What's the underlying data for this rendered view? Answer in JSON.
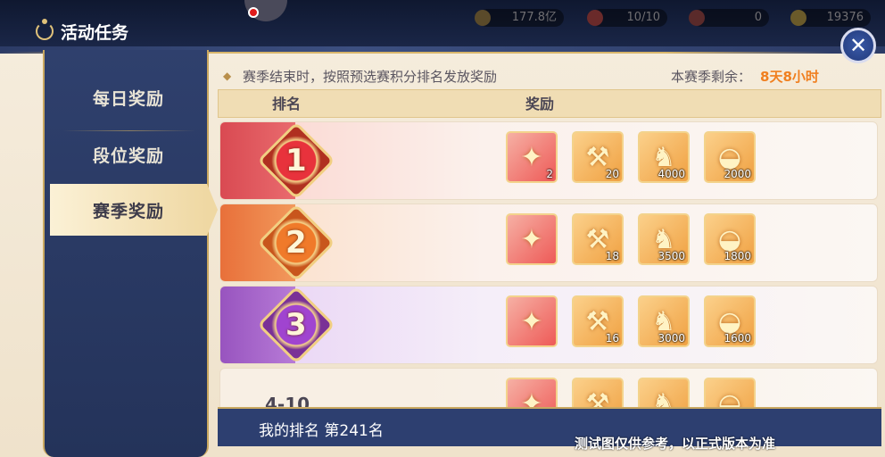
{
  "topbar": {
    "title": "活动任务",
    "resources": [
      "177.8亿",
      "10/10",
      "0",
      "19376"
    ],
    "colors": {
      "accent": "#e0c27a"
    }
  },
  "sidebar": {
    "items": [
      {
        "label": "每日奖励",
        "active": false
      },
      {
        "label": "段位奖励",
        "active": false
      },
      {
        "label": "赛季奖励",
        "active": true
      }
    ]
  },
  "notice": {
    "text": "赛季结束时，按照预选赛积分排名发放奖励",
    "remain_label": "本赛季剩余：",
    "remain_value": "8天8小时"
  },
  "table": {
    "col_rank": "排名",
    "col_reward": "奖励",
    "rows": [
      {
        "rank": "1",
        "items": [
          {
            "icon": "scepter-icon",
            "qty": "2"
          },
          {
            "icon": "hammer-icon",
            "qty": "20"
          },
          {
            "icon": "dragon-icon",
            "qty": "4000"
          },
          {
            "icon": "gold-ingot-icon",
            "qty": "2000"
          }
        ]
      },
      {
        "rank": "2",
        "items": [
          {
            "icon": "scepter-icon",
            "qty": ""
          },
          {
            "icon": "hammer-icon",
            "qty": "18"
          },
          {
            "icon": "dragon-icon",
            "qty": "3500"
          },
          {
            "icon": "gold-ingot-icon",
            "qty": "1800"
          }
        ]
      },
      {
        "rank": "3",
        "items": [
          {
            "icon": "scepter-icon",
            "qty": ""
          },
          {
            "icon": "hammer-icon",
            "qty": "16"
          },
          {
            "icon": "dragon-icon",
            "qty": "3000"
          },
          {
            "icon": "gold-ingot-icon",
            "qty": "1600"
          }
        ]
      },
      {
        "rank": "4-10",
        "items": [
          {
            "icon": "scepter-icon",
            "qty": ""
          },
          {
            "icon": "hammer-icon",
            "qty": ""
          },
          {
            "icon": "dragon-icon",
            "qty": ""
          },
          {
            "icon": "gold-ingot-icon",
            "qty": ""
          }
        ]
      }
    ]
  },
  "my_rank": {
    "label": "我的排名 第241名",
    "watermark": "测试图仅供参考，以正式版本为准"
  }
}
